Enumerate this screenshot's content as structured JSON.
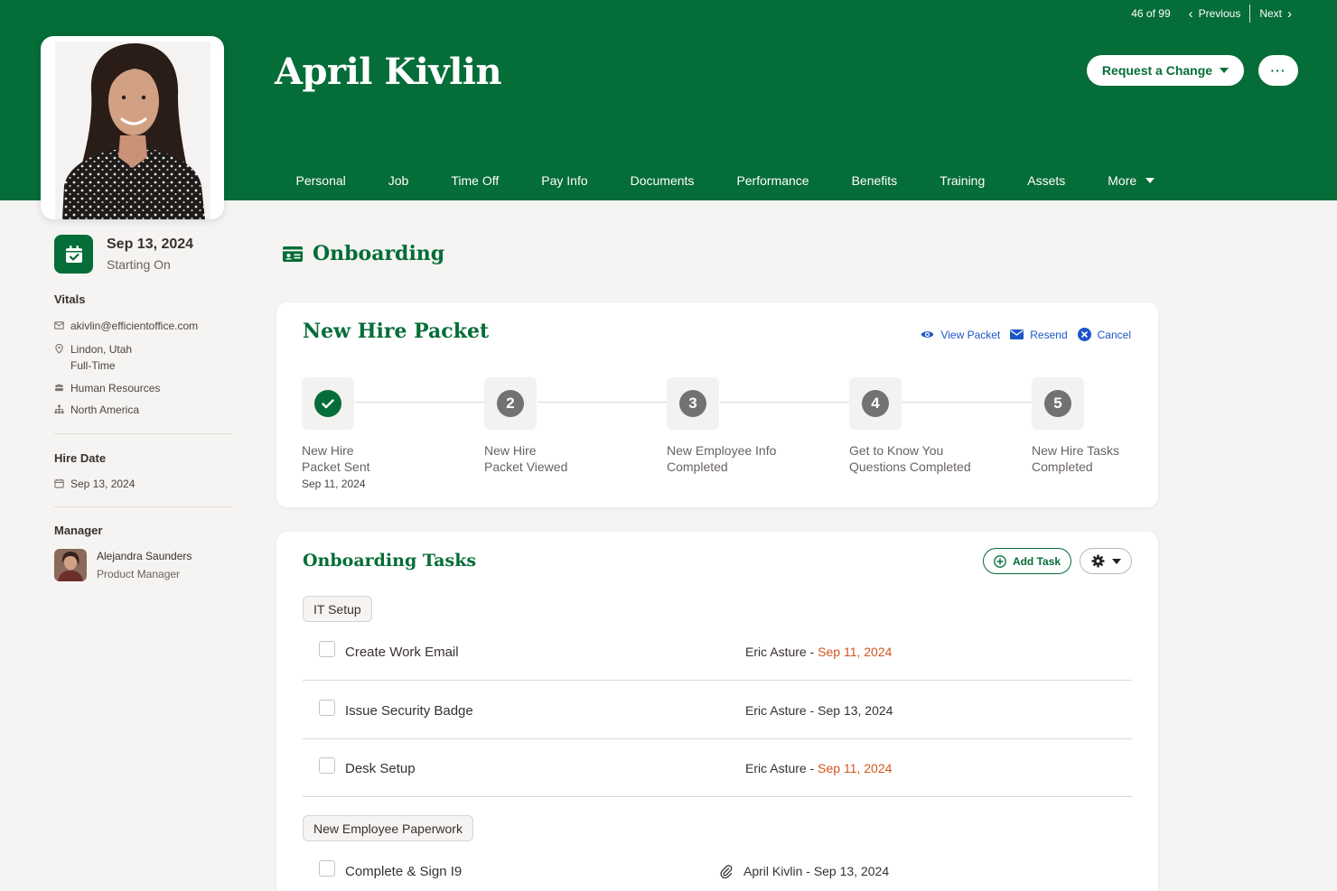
{
  "pager": {
    "count": "46 of 99",
    "previous": "Previous",
    "next": "Next"
  },
  "employee": {
    "name": "April Kivlin"
  },
  "header_actions": {
    "request_change": "Request a Change",
    "more_menu": "···"
  },
  "tabs": [
    "Personal",
    "Job",
    "Time Off",
    "Pay Info",
    "Documents",
    "Performance",
    "Benefits",
    "Training",
    "Assets",
    "More"
  ],
  "start": {
    "date": "Sep 13, 2024",
    "label": "Starting On"
  },
  "vitals": {
    "title": "Vitals",
    "email": "akivlin@efficientoffice.com",
    "location": "Lindon, Utah",
    "employment_type": "Full-Time",
    "department": "Human Resources",
    "division": "North America"
  },
  "hire": {
    "title": "Hire Date",
    "date": "Sep 13, 2024"
  },
  "manager": {
    "title": "Manager",
    "name": "Alejandra Saunders",
    "role": "Product Manager"
  },
  "section": {
    "title": "Onboarding"
  },
  "packet": {
    "title": "New Hire Packet",
    "actions": {
      "view": "View Packet",
      "resend": "Resend",
      "cancel": "Cancel"
    },
    "steps": [
      {
        "number": "1",
        "label_line1": "New Hire",
        "label_line2": "Packet Sent",
        "date": "Sep 11, 2024",
        "completed": true
      },
      {
        "number": "2",
        "label_line1": "New Hire",
        "label_line2": "Packet Viewed",
        "date": "",
        "completed": false
      },
      {
        "number": "3",
        "label_line1": "New Employee Info",
        "label_line2": "Completed",
        "date": "",
        "completed": false
      },
      {
        "number": "4",
        "label_line1": "Get to Know You",
        "label_line2": "Questions Completed",
        "date": "",
        "completed": false
      },
      {
        "number": "5",
        "label_line1": "New Hire Tasks",
        "label_line2": "Completed",
        "date": "",
        "completed": false
      }
    ]
  },
  "tasks": {
    "title": "Onboarding Tasks",
    "add_task": "Add Task",
    "groups": [
      {
        "name": "IT Setup",
        "items": [
          {
            "name": "Create Work Email",
            "assignee": "Eric Asture",
            "separator": " - ",
            "due": "Sep 11, 2024",
            "overdue": true
          },
          {
            "name": "Issue Security Badge",
            "assignee": "Eric Asture",
            "separator": " - ",
            "due": "Sep 13, 2024",
            "overdue": false
          },
          {
            "name": "Desk Setup",
            "assignee": "Eric Asture",
            "separator": " - ",
            "due": "Sep 11, 2024",
            "overdue": true
          }
        ]
      },
      {
        "name": "New Employee Paperwork",
        "items": [
          {
            "name": "Complete & Sign I9",
            "assignee": "April Kivlin",
            "separator": " - ",
            "due": "Sep 13, 2024",
            "overdue": false,
            "attachment": true
          }
        ]
      }
    ]
  },
  "colors": {
    "brand": "#056d37",
    "link": "#1c56c7",
    "overdue": "#d5541f",
    "step_inactive": "#727272"
  }
}
